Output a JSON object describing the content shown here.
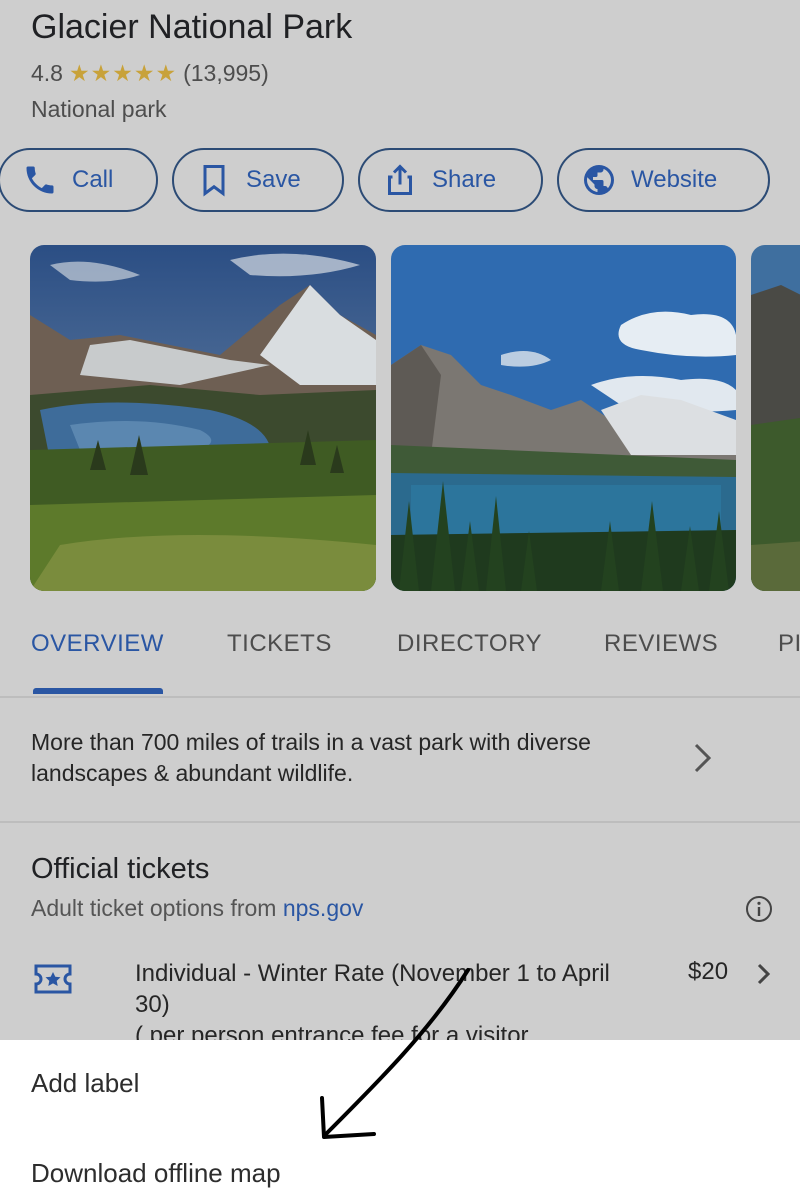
{
  "place": {
    "title": "Glacier National Park",
    "rating": "4.8",
    "stars": "★★★★★",
    "review_count": "(13,995)",
    "category": "National park"
  },
  "actions": {
    "call": "Call",
    "save": "Save",
    "share": "Share",
    "website": "Website"
  },
  "tabs": {
    "overview": "OVERVIEW",
    "tickets": "TICKETS",
    "directory": "DIRECTORY",
    "reviews": "REVIEWS",
    "more": "PI"
  },
  "summary": "More than 700 miles of trails in a vast park with diverse landscapes & abundant wildlife.",
  "official_tickets": {
    "title": "Official tickets",
    "subtitle_prefix": "Adult ticket options from ",
    "subtitle_link": "nps.gov",
    "item_name": "Individual - Winter Rate (November 1 to April 30)",
    "item_detail": "( per person entrance fee for a visitor",
    "item_price": "$20"
  },
  "bottom_sheet": {
    "add_label": "Add label",
    "download_offline_map": "Download offline map"
  },
  "icons": {
    "call": "phone-icon",
    "save": "bookmark-icon",
    "share": "share-icon",
    "website": "globe-icon",
    "info": "info-icon",
    "ticket": "ticket-icon",
    "chevron": "chevron-right-icon"
  },
  "colors": {
    "accent": "#2a56a3",
    "star": "#c8a23a",
    "dim_overlay_bg": "#cecece",
    "sheet_bg": "#ffffff"
  }
}
